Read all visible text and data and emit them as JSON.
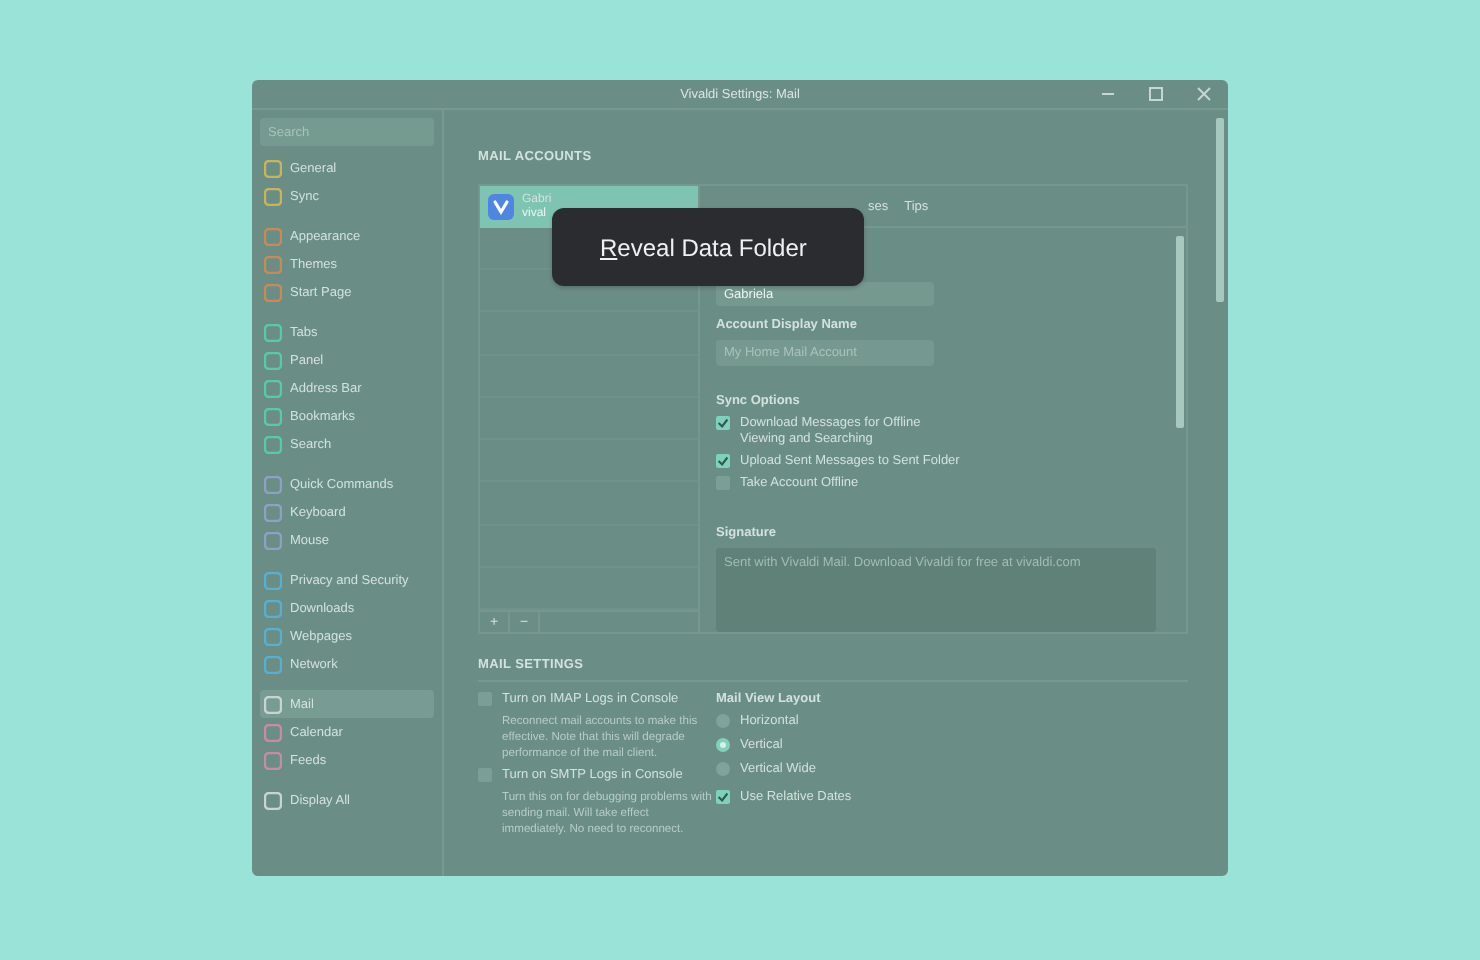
{
  "window": {
    "title": "Vivaldi Settings: Mail"
  },
  "sidebar": {
    "search": {
      "placeholder": "Search"
    },
    "groups": [
      {
        "items": [
          {
            "label": "General",
            "color": "#c9b45a",
            "selected": false
          },
          {
            "label": "Sync",
            "color": "#c9b45a",
            "selected": false
          }
        ]
      },
      {
        "items": [
          {
            "label": "Appearance",
            "color": "#c98a5a",
            "selected": false
          },
          {
            "label": "Themes",
            "color": "#c98a5a",
            "selected": false
          },
          {
            "label": "Start Page",
            "color": "#c98a5a",
            "selected": false
          }
        ]
      },
      {
        "items": [
          {
            "label": "Tabs",
            "color": "#5ac9a8",
            "selected": false
          },
          {
            "label": "Panel",
            "color": "#5ac9a8",
            "selected": false
          },
          {
            "label": "Address Bar",
            "color": "#5ac9a8",
            "selected": false
          },
          {
            "label": "Bookmarks",
            "color": "#5ac9a8",
            "selected": false
          },
          {
            "label": "Search",
            "color": "#5ac9a8",
            "selected": false
          }
        ]
      },
      {
        "items": [
          {
            "label": "Quick Commands",
            "color": "#8fa0c8",
            "selected": false
          },
          {
            "label": "Keyboard",
            "color": "#8fa0c8",
            "selected": false
          },
          {
            "label": "Mouse",
            "color": "#8fa0c8",
            "selected": false
          }
        ]
      },
      {
        "items": [
          {
            "label": "Privacy and Security",
            "color": "#5aaed0",
            "selected": false
          },
          {
            "label": "Downloads",
            "color": "#5aaed0",
            "selected": false
          },
          {
            "label": "Webpages",
            "color": "#5aaed0",
            "selected": false
          },
          {
            "label": "Network",
            "color": "#5aaed0",
            "selected": false
          }
        ]
      },
      {
        "items": [
          {
            "label": "Mail",
            "color": "#c8d4d0",
            "selected": true
          },
          {
            "label": "Calendar",
            "color": "#c88aa8",
            "selected": false
          },
          {
            "label": "Feeds",
            "color": "#c88aa8",
            "selected": false
          }
        ]
      },
      {
        "items": [
          {
            "label": "Display All",
            "color": "#c8d4d0",
            "selected": false
          }
        ]
      }
    ]
  },
  "mail_accounts": {
    "heading": "MAIL ACCOUNTS",
    "accounts": [
      {
        "name": "Gabri",
        "address": "vival",
        "selected": true
      }
    ],
    "list_buttons": [
      "+",
      "−"
    ],
    "tabs": [
      {
        "label": "ses",
        "selected": false
      },
      {
        "label": "Tips",
        "selected": false
      }
    ],
    "name_field": {
      "value": "Gabriela"
    },
    "display_name": {
      "label": "Account Display Name",
      "placeholder": "My Home Mail Account"
    },
    "sync_options": {
      "label": "Sync Options",
      "options": [
        {
          "label": "Download Messages for Offline Viewing and Searching",
          "checked": true
        },
        {
          "label": "Upload Sent Messages to Sent Folder",
          "checked": true
        },
        {
          "label": "Take Account Offline",
          "checked": false
        }
      ]
    },
    "signature": {
      "label": "Signature",
      "placeholder": "Sent with Vivaldi Mail. Download Vivaldi for free at vivaldi.com"
    }
  },
  "mail_settings": {
    "heading": "MAIL SETTINGS",
    "logs": [
      {
        "label": "Turn on IMAP Logs in Console",
        "checked": false,
        "description": "Reconnect mail accounts to make this effective. Note that this will degrade performance of the mail client."
      },
      {
        "label": "Turn on SMTP Logs in Console",
        "checked": false,
        "description": "Turn this on for debugging problems with sending mail. Will take effect immediately. No need to reconnect."
      }
    ],
    "layout": {
      "label": "Mail View Layout",
      "options": [
        {
          "label": "Horizontal",
          "selected": false
        },
        {
          "label": "Vertical",
          "selected": true
        },
        {
          "label": "Vertical Wide",
          "selected": false
        }
      ]
    },
    "relative_dates": {
      "label": "Use Relative Dates",
      "checked": true
    }
  },
  "context_menu": {
    "items": [
      {
        "label": "Reveal Data Folder"
      }
    ]
  }
}
